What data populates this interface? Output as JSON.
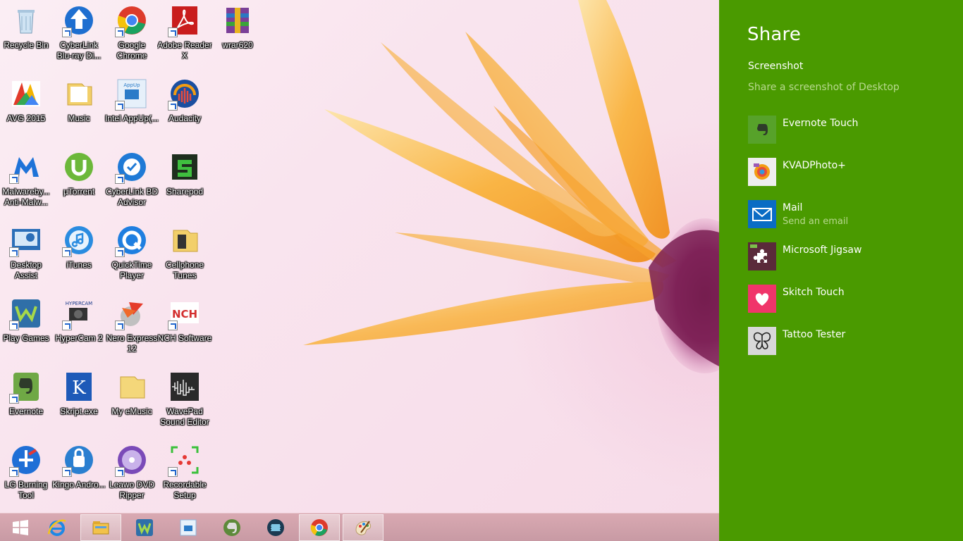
{
  "desktop": {
    "icons": [
      {
        "label": "Recycle Bin",
        "icon": "recycle-bin-icon"
      },
      {
        "label": "CyberLink Blu-ray Di...",
        "icon": "cyberlink-bluray-icon"
      },
      {
        "label": "Google Chrome",
        "icon": "chrome-icon"
      },
      {
        "label": "Adobe Reader X",
        "icon": "adobe-reader-icon"
      },
      {
        "label": "wrar620",
        "icon": "winrar-icon"
      },
      {
        "label": "AVG 2015",
        "icon": "avg-icon"
      },
      {
        "label": "Music",
        "icon": "music-folder-icon"
      },
      {
        "label": "Intel AppUp(...",
        "icon": "intel-appup-icon"
      },
      {
        "label": "Audacity",
        "icon": "audacity-icon"
      },
      {
        "label": "Malwareby... Anti-Malw...",
        "icon": "malwarebytes-icon"
      },
      {
        "label": "µTorrent",
        "icon": "utorrent-icon"
      },
      {
        "label": "CyberLink BD Advisor",
        "icon": "cyberlink-bd-advisor-icon"
      },
      {
        "label": "Sharepod",
        "icon": "sharepod-icon"
      },
      {
        "label": "Desktop Assist",
        "icon": "desktop-assist-icon"
      },
      {
        "label": "iTunes",
        "icon": "itunes-icon"
      },
      {
        "label": "QuickTime Player",
        "icon": "quicktime-icon"
      },
      {
        "label": "Cellphone Tunes",
        "icon": "cellphone-tunes-folder-icon"
      },
      {
        "label": "Play Games",
        "icon": "play-games-icon"
      },
      {
        "label": "HyperCam 2",
        "icon": "hypercam-icon"
      },
      {
        "label": "Nero Express 12",
        "icon": "nero-express-icon"
      },
      {
        "label": "NCH Software",
        "icon": "nch-software-icon"
      },
      {
        "label": "Evernote",
        "icon": "evernote-icon"
      },
      {
        "label": "Skript.exe",
        "icon": "skript-icon"
      },
      {
        "label": "My eMusic",
        "icon": "emusic-folder-icon"
      },
      {
        "label": "WavePad Sound Editor",
        "icon": "wavepad-icon"
      },
      {
        "label": "LG Burning Tool",
        "icon": "lg-burning-tool-icon"
      },
      {
        "label": "Kingo Andro...",
        "icon": "kingo-android-icon"
      },
      {
        "label": "Leawo DVD Ripper",
        "icon": "leawo-dvd-ripper-icon"
      },
      {
        "label": "Recordable Setup",
        "icon": "recordable-setup-icon"
      }
    ]
  },
  "taskbar": {
    "items": [
      {
        "icon": "windows-start-icon"
      },
      {
        "icon": "internet-explorer-icon"
      },
      {
        "icon": "file-explorer-icon"
      },
      {
        "icon": "play-games-taskbar-icon"
      },
      {
        "icon": "intel-appup-taskbar-icon"
      },
      {
        "icon": "evernote-taskbar-icon"
      },
      {
        "icon": "media-player-taskbar-icon"
      },
      {
        "icon": "chrome-taskbar-icon"
      },
      {
        "icon": "paint-taskbar-icon"
      }
    ]
  },
  "share": {
    "title": "Share",
    "subtitle": "Screenshot",
    "description": "Share a screenshot of Desktop",
    "apps": [
      {
        "name": "Evernote Touch",
        "sub": "",
        "icon": "evernote-touch-icon"
      },
      {
        "name": "KVADPhoto+",
        "sub": "",
        "icon": "kvadphoto-icon"
      },
      {
        "name": "Mail",
        "sub": "Send an email",
        "icon": "mail-icon"
      },
      {
        "name": "Microsoft Jigsaw",
        "sub": "",
        "icon": "jigsaw-icon"
      },
      {
        "name": "Skitch Touch",
        "sub": "",
        "icon": "skitch-icon"
      },
      {
        "name": "Tattoo Tester",
        "sub": "",
        "icon": "tattoo-tester-icon"
      }
    ]
  },
  "colors": {
    "share_bg": "#4a9a00",
    "share_secondary_text": "#b8d98f",
    "mail_blue": "#0a6cc4",
    "skitch_pink": "#f0356a"
  }
}
